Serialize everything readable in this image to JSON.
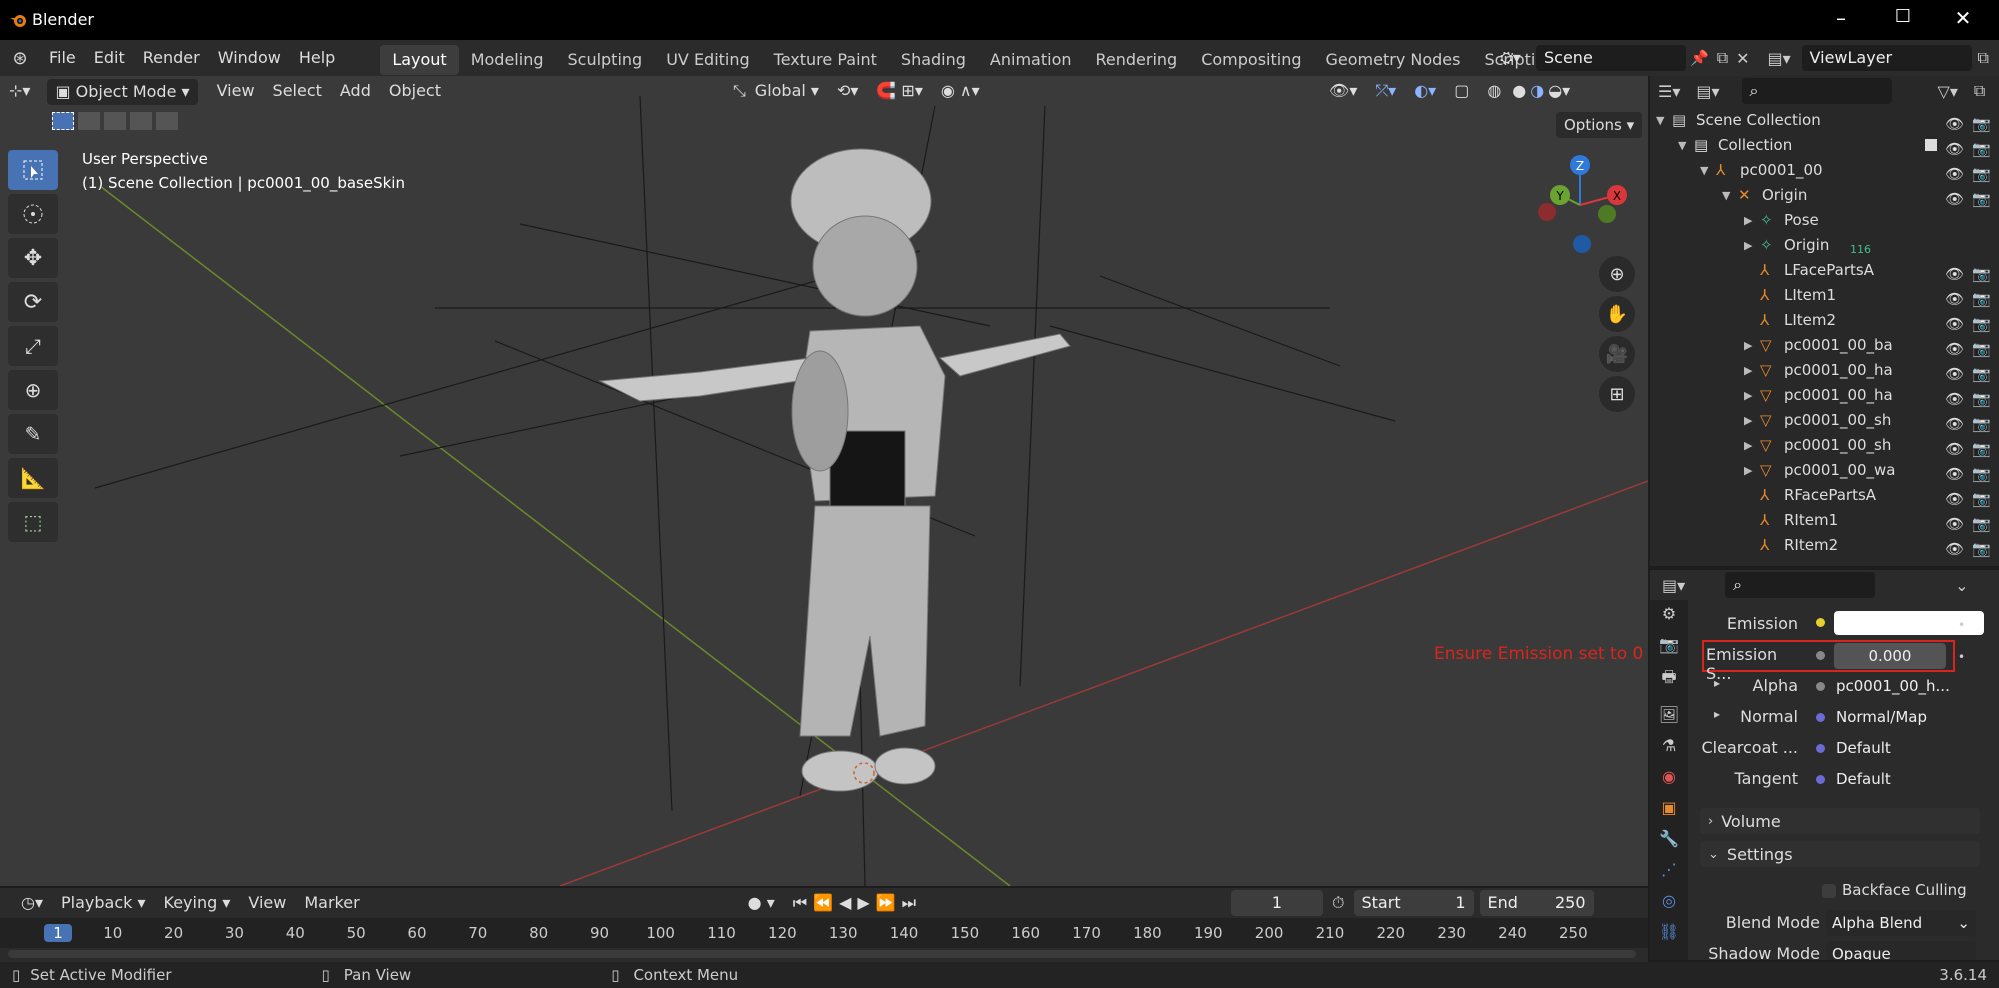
{
  "window": {
    "title": "Blender"
  },
  "menu": [
    "File",
    "Edit",
    "Render",
    "Window",
    "Help"
  ],
  "workspaces": [
    "Layout",
    "Modeling",
    "Sculpting",
    "UV Editing",
    "Texture Paint",
    "Shading",
    "Animation",
    "Rendering",
    "Compositing",
    "Geometry Nodes",
    "Scripting"
  ],
  "scene": {
    "name": "Scene",
    "view_layer": "ViewLayer"
  },
  "viewport": {
    "mode": "Object Mode",
    "menus": [
      "View",
      "Select",
      "Add",
      "Object"
    ],
    "transform": "Global",
    "options_label": "Options",
    "info_line1": "User Perspective",
    "info_line2": "(1) Scene Collection | pc0001_00_baseSkin",
    "annotation": "Ensure Emission set to 0",
    "gizmo": {
      "z": "Z",
      "y": "Y",
      "x": "X"
    },
    "colors": {
      "bg": "#3a3a3a",
      "accent": "#4772b3",
      "annotation": "#d9261c"
    }
  },
  "outliner": {
    "rows": [
      {
        "label": "Scene Collection",
        "indent": 0,
        "icon": "scene-collection-icon"
      },
      {
        "label": "Collection",
        "indent": 1,
        "icon": "collection-icon"
      },
      {
        "label": "pc0001_00",
        "indent": 2,
        "icon": "armature-object-icon"
      },
      {
        "label": "Origin",
        "indent": 3,
        "icon": "armature-data-icon"
      },
      {
        "label": "Pose",
        "indent": 4,
        "icon": "pose-icon"
      },
      {
        "label": "Origin",
        "indent": 4,
        "icon": "bone-icon",
        "badge": "116"
      },
      {
        "label": "LFacePartsA",
        "indent": 4,
        "icon": "empty-icon"
      },
      {
        "label": "LItem1",
        "indent": 4,
        "icon": "empty-icon"
      },
      {
        "label": "LItem2",
        "indent": 4,
        "icon": "empty-icon"
      },
      {
        "label": "pc0001_00_ba",
        "indent": 4,
        "icon": "mesh-icon"
      },
      {
        "label": "pc0001_00_ha",
        "indent": 4,
        "icon": "mesh-icon"
      },
      {
        "label": "pc0001_00_ha",
        "indent": 4,
        "icon": "mesh-icon"
      },
      {
        "label": "pc0001_00_sh",
        "indent": 4,
        "icon": "mesh-icon"
      },
      {
        "label": "pc0001_00_sh",
        "indent": 4,
        "icon": "mesh-icon"
      },
      {
        "label": "pc0001_00_wa",
        "indent": 4,
        "icon": "mesh-icon"
      },
      {
        "label": "RFacePartsA",
        "indent": 4,
        "icon": "empty-icon"
      },
      {
        "label": "RItem1",
        "indent": 4,
        "icon": "empty-icon"
      },
      {
        "label": "RItem2",
        "indent": 4,
        "icon": "empty-icon"
      }
    ]
  },
  "properties": {
    "emission_label": "Emission",
    "emission_strength_label": "Emission S...",
    "emission_strength_value": "0.000",
    "alpha_label": "Alpha",
    "alpha_value": "pc0001_00_h...",
    "normal_label": "Normal",
    "normal_value": "Normal/Map",
    "clearcoat_label": "Clearcoat ...",
    "clearcoat_value": "Default",
    "tangent_label": "Tangent",
    "tangent_value": "Default",
    "volume_label": "Volume",
    "settings_label": "Settings",
    "backface_label": "Backface Culling",
    "blend_mode_label": "Blend Mode",
    "blend_mode_value": "Alpha Blend",
    "shadow_mode_label": "Shadow Mode",
    "shadow_mode_value": "Opaque"
  },
  "timeline": {
    "menus": [
      "Playback",
      "Keying",
      "View",
      "Marker"
    ],
    "current_frame": "1",
    "start_label": "Start",
    "start": "1",
    "end_label": "End",
    "end": "250",
    "ticks": [
      "1",
      "10",
      "20",
      "30",
      "40",
      "50",
      "60",
      "70",
      "80",
      "90",
      "100",
      "110",
      "120",
      "130",
      "140",
      "150",
      "160",
      "170",
      "180",
      "190",
      "200",
      "210",
      "220",
      "230",
      "240",
      "250"
    ]
  },
  "status": {
    "left": "Set Active Modifier",
    "middle": "Pan View",
    "right": "Context Menu",
    "version": "3.6.14"
  }
}
